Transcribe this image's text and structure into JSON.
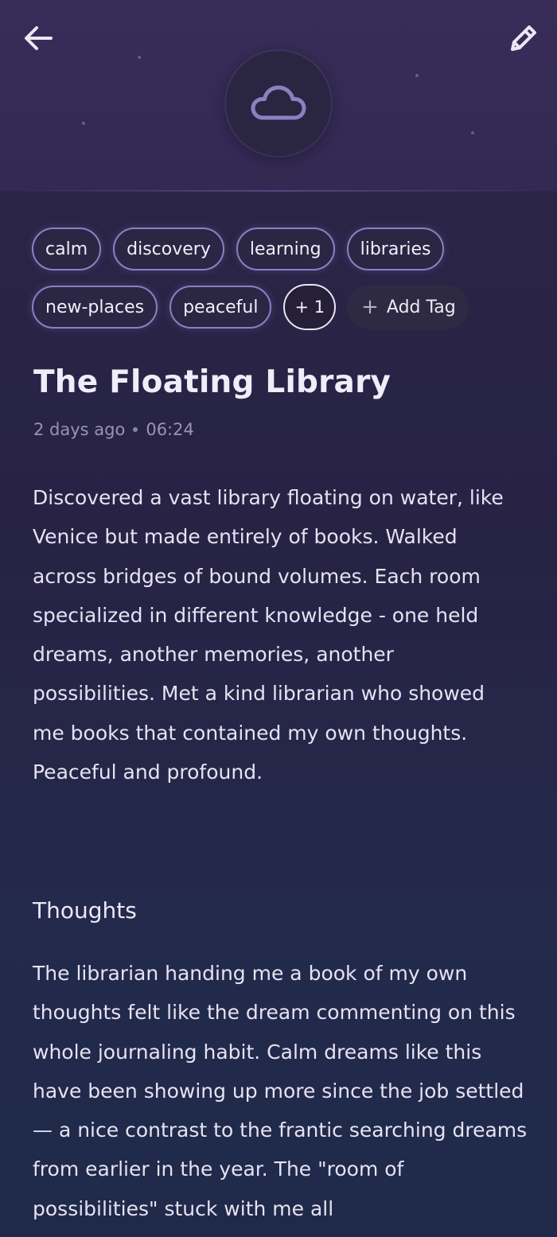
{
  "header": {
    "back_icon": "arrow-left-icon",
    "edit_icon": "pencil-icon",
    "mood_icon": "cloud-icon",
    "colors": {
      "accent": "#8f7ec2",
      "cloud": "#8e7fc1"
    }
  },
  "tags": {
    "items": [
      "calm",
      "discovery",
      "learning",
      "libraries",
      "new-places",
      "peaceful"
    ],
    "more_label": "+ 1",
    "add_label": "Add Tag"
  },
  "dream": {
    "title": "The Floating Library",
    "relative_date": "2 days ago",
    "time": "06:24",
    "body": "Discovered a vast library floating on water, like Venice but made entirely of books. Walked across bridges of bound volumes. Each room specialized in different knowledge - one held dreams, another memories, another possibilities. Met a kind librarian who showed me books that contained my own thoughts. Peaceful and profound."
  },
  "thoughts": {
    "heading": "Thoughts",
    "text": "The librarian handing me a book of my own thoughts felt like the dream commenting on this whole journaling habit. Calm dreams like this have been showing up more since the job settled — a nice contrast to the frantic searching dreams from earlier in the year. The \"room of possibilities\" stuck with me all"
  }
}
